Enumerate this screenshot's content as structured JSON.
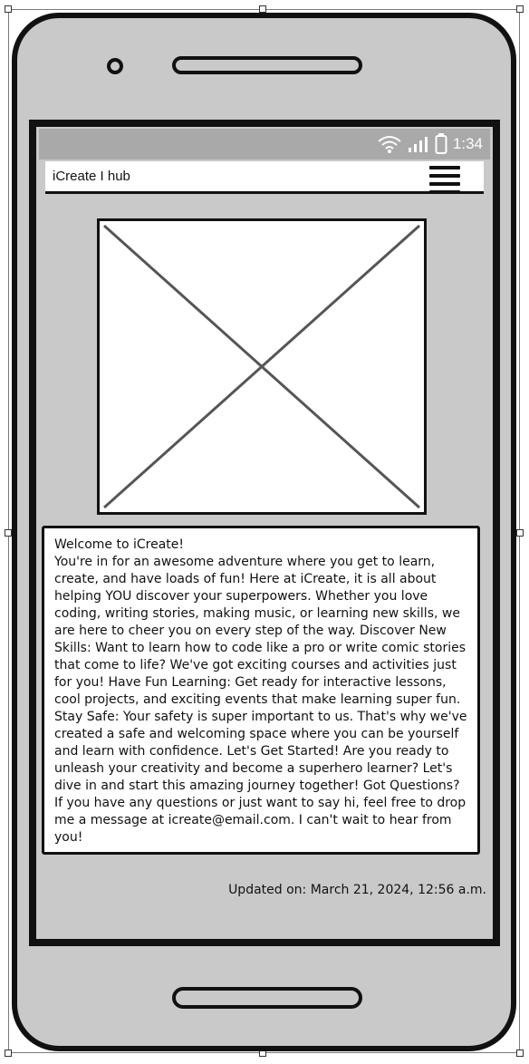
{
  "status_bar": {
    "time": "1:34",
    "icons": [
      "wifi-icon",
      "signal-icon",
      "battery-icon"
    ]
  },
  "navbar": {
    "title": "iCreate I hub",
    "menu_icon": "hamburger-menu-icon"
  },
  "image_placeholder": {
    "icon": "image-placeholder-icon"
  },
  "content": {
    "heading": "Welcome to iCreate!",
    "body": "You're in for an awesome adventure where you get to learn, create, and have loads of fun! Here at iCreate, it is all about helping YOU discover your superpowers. Whether you love coding, writing stories, making music, or learning new skills, we are here to cheer you on every step of the way. Discover New Skills: Want to learn how to code like a pro or write comic stories that come to life? We've got exciting courses and activities just for you! Have Fun Learning: Get ready for interactive lessons, cool projects, and exciting events that make learning super fun. Stay Safe: Your safety is super important to us. That's why we've created a safe and welcoming space where you can be yourself and learn with confidence. Let's Get Started! Are you ready to unleash your creativity and become a superhero learner? Let's dive in and start this amazing journey together! Got Questions? If you have any questions or just want to say hi, feel free to drop me a message at icreate@email.com. I can't wait to hear from you!"
  },
  "footer": {
    "updated": "Updated on: March 21, 2024, 12:56 a.m."
  },
  "colors": {
    "phone_body": "#c9c9c9",
    "status_bar": "#a9a9a9",
    "outline": "#111111"
  }
}
